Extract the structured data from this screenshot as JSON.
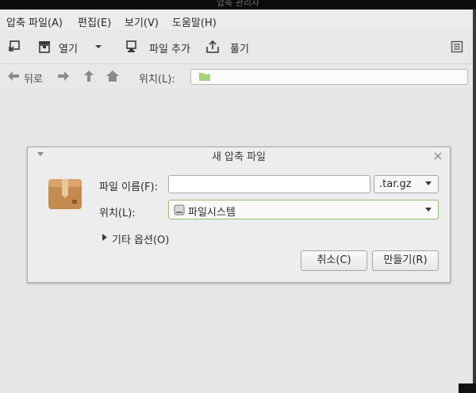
{
  "window": {
    "title": "압축 관리자"
  },
  "menubar": {
    "items": [
      {
        "label": "압축 파일(A)"
      },
      {
        "label": "편집(E)"
      },
      {
        "label": "보기(V)"
      },
      {
        "label": "도움말(H)"
      }
    ]
  },
  "toolbar": {
    "new_icon": "new-archive-icon",
    "open_label": "열기",
    "add_files_label": "파일 추가",
    "extract_label": "풀기",
    "details_icon": "list-view-icon"
  },
  "locationbar": {
    "back_label": "뒤로",
    "location_label": "위치(L):",
    "location_value": ""
  },
  "dialog": {
    "title": "새 압축 파일",
    "filename_label": "파일 이름(F):",
    "filename_value": "",
    "extension_value": ".tar.gz",
    "location_label": "위치(L):",
    "location_value": "파일시스템",
    "other_options_label": "기타 옵션(O)",
    "cancel_label": "취소(C)",
    "create_label": "만들기(R)"
  },
  "colors": {
    "accent_border": "#8fbf6a",
    "folder": "#9fcf6f",
    "archive_icon": "#c48a4e"
  }
}
